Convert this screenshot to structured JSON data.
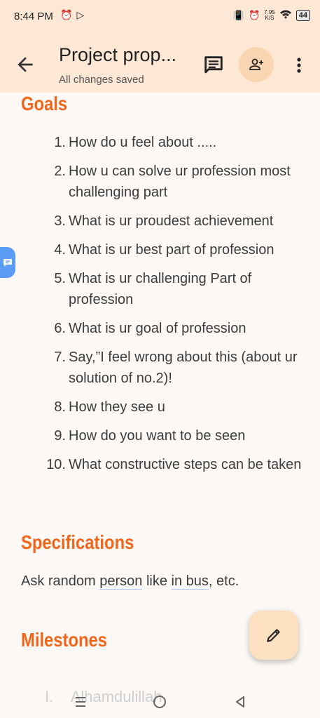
{
  "status_bar": {
    "time": "8:44 PM",
    "net_speed_value": "7.95",
    "net_speed_unit": "K/S",
    "battery": "44"
  },
  "toolbar": {
    "title": "Project prop...",
    "status": "All changes saved"
  },
  "document": {
    "goals_heading": "Goals",
    "goals": [
      {
        "num": "1.",
        "text": "How do u feel about ....."
      },
      {
        "num": "2.",
        "text": "How u can solve ur profession most challenging part"
      },
      {
        "num": "3.",
        "text": "What is ur proudest achievement"
      },
      {
        "num": "4.",
        "text": "What is ur best part of profession"
      },
      {
        "num": "5.",
        "text": "What is ur challenging Part of profession"
      },
      {
        "num": "6.",
        "text": "What is ur goal of profession"
      },
      {
        "num": "7.",
        "text": "Say,”I feel wrong about this (about ur solution of no.2)!"
      },
      {
        "num": "8.",
        "text": "How they see u"
      },
      {
        "num": "9.",
        "text": "How do you want to be seen"
      },
      {
        "num": "10.",
        "text": "What constructive steps can be taken"
      }
    ],
    "specifications_heading": "Specifications",
    "spec_part1": "Ask random ",
    "spec_underline1": "person",
    "spec_part2": " like ",
    "spec_underline2": "in bus",
    "spec_part3": ", etc.",
    "milestones_heading": "Milestones",
    "milestone_num": "I.",
    "milestone_text": "Alhamdulillah"
  },
  "colors": {
    "heading": "#f0661b",
    "toolbar_bg": "#fde8d6",
    "fab_bg": "#fde0c2"
  }
}
